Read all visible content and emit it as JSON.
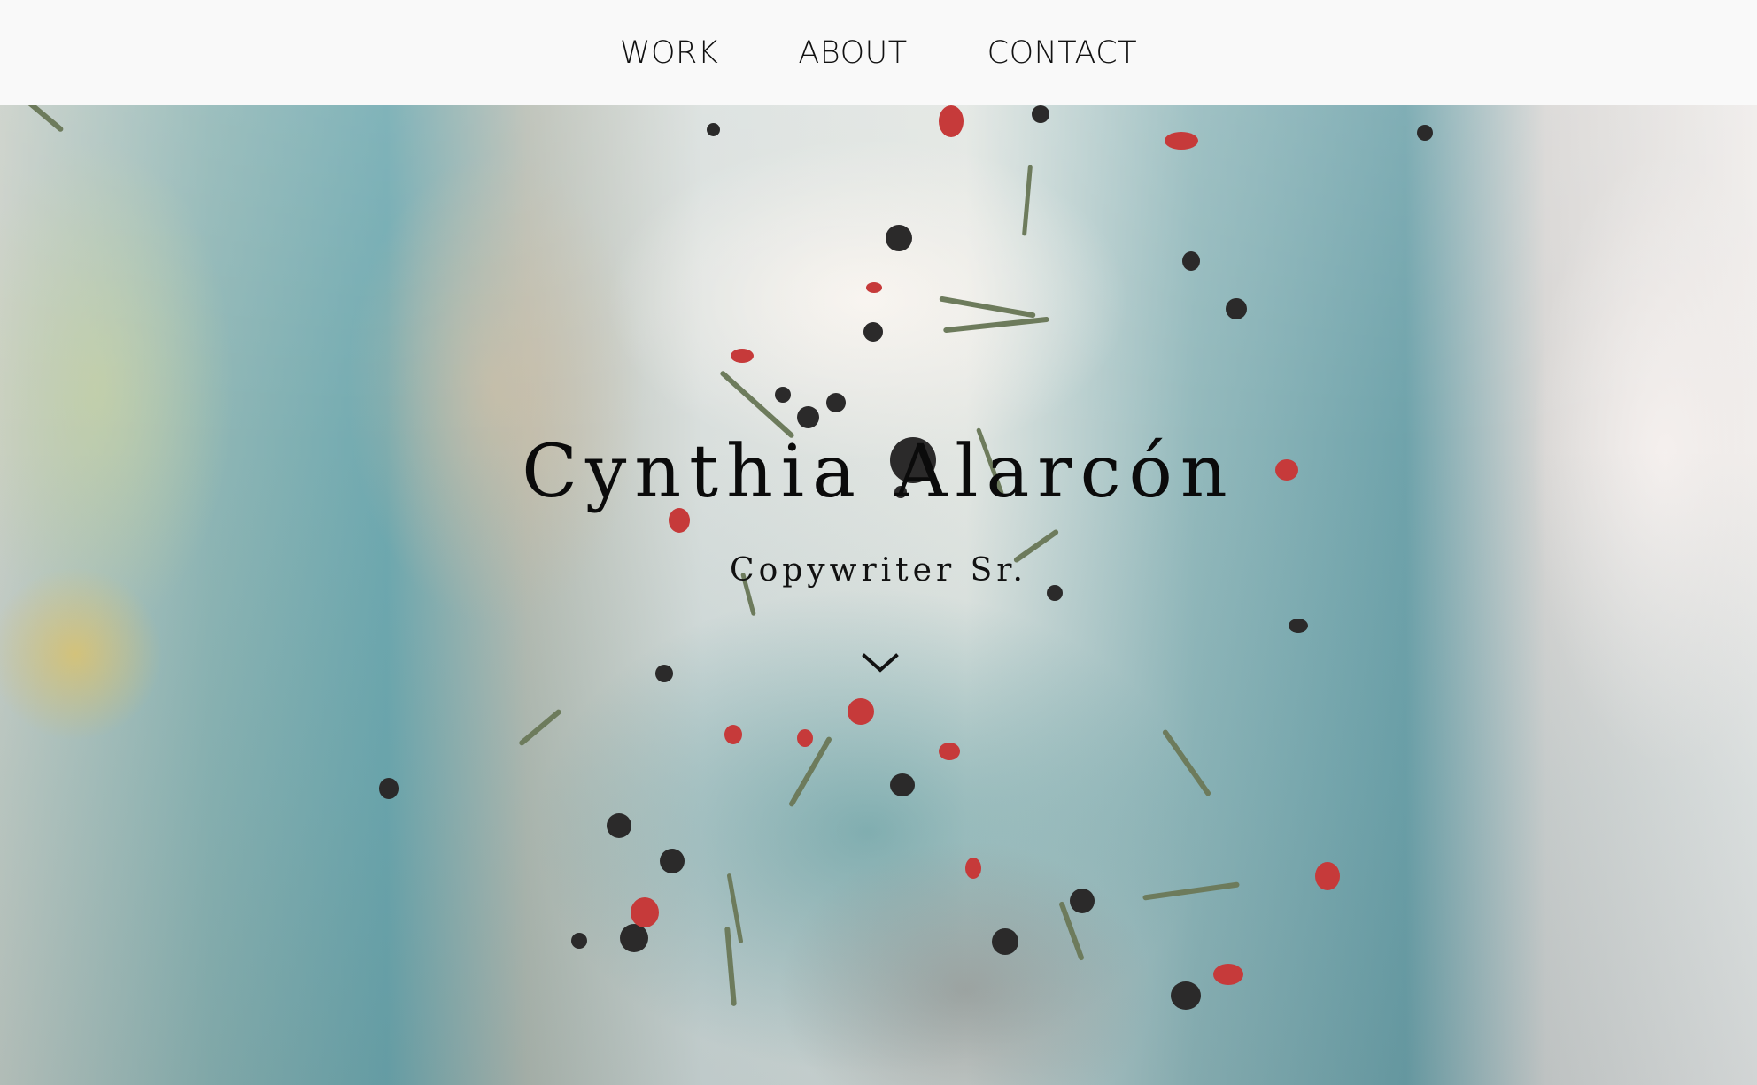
{
  "nav": {
    "items": [
      "WORK",
      "ABOUT",
      "CONTACT"
    ]
  },
  "hero": {
    "title": "Cynthia Alarcón",
    "subtitle": "Copywriter Sr.",
    "scroll_icon": "chevron-down-icon"
  },
  "colors": {
    "nav_background": "#f9f9f9",
    "text": "#0b0b0b",
    "hero_teal": "#6fa9b0"
  }
}
